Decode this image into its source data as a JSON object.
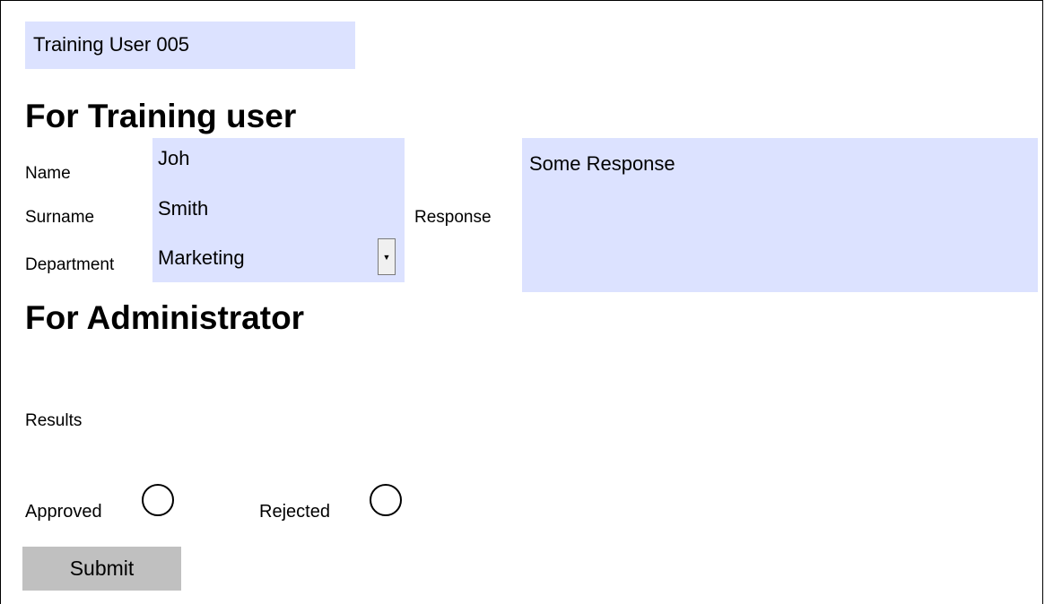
{
  "header": {
    "title_field_value": "Training User 005"
  },
  "training_section": {
    "heading": "For Training user",
    "name_label": "Name",
    "name_value": "Joh",
    "surname_label": "Surname",
    "surname_value": "Smith",
    "department_label": "Department",
    "department_value": "Marketing",
    "dropdown_icon": "dropdown-arrow-icon",
    "response_label": "Response",
    "response_value": "Some Response"
  },
  "admin_section": {
    "heading": "For Administrator",
    "results_label": "Results",
    "approved_label": "Approved",
    "rejected_label": "Rejected",
    "approved_checked": false,
    "rejected_checked": false,
    "submit_label": "Submit"
  },
  "colors": {
    "field_fill": "#dce2ff",
    "button_fill": "#c0c0c0"
  }
}
